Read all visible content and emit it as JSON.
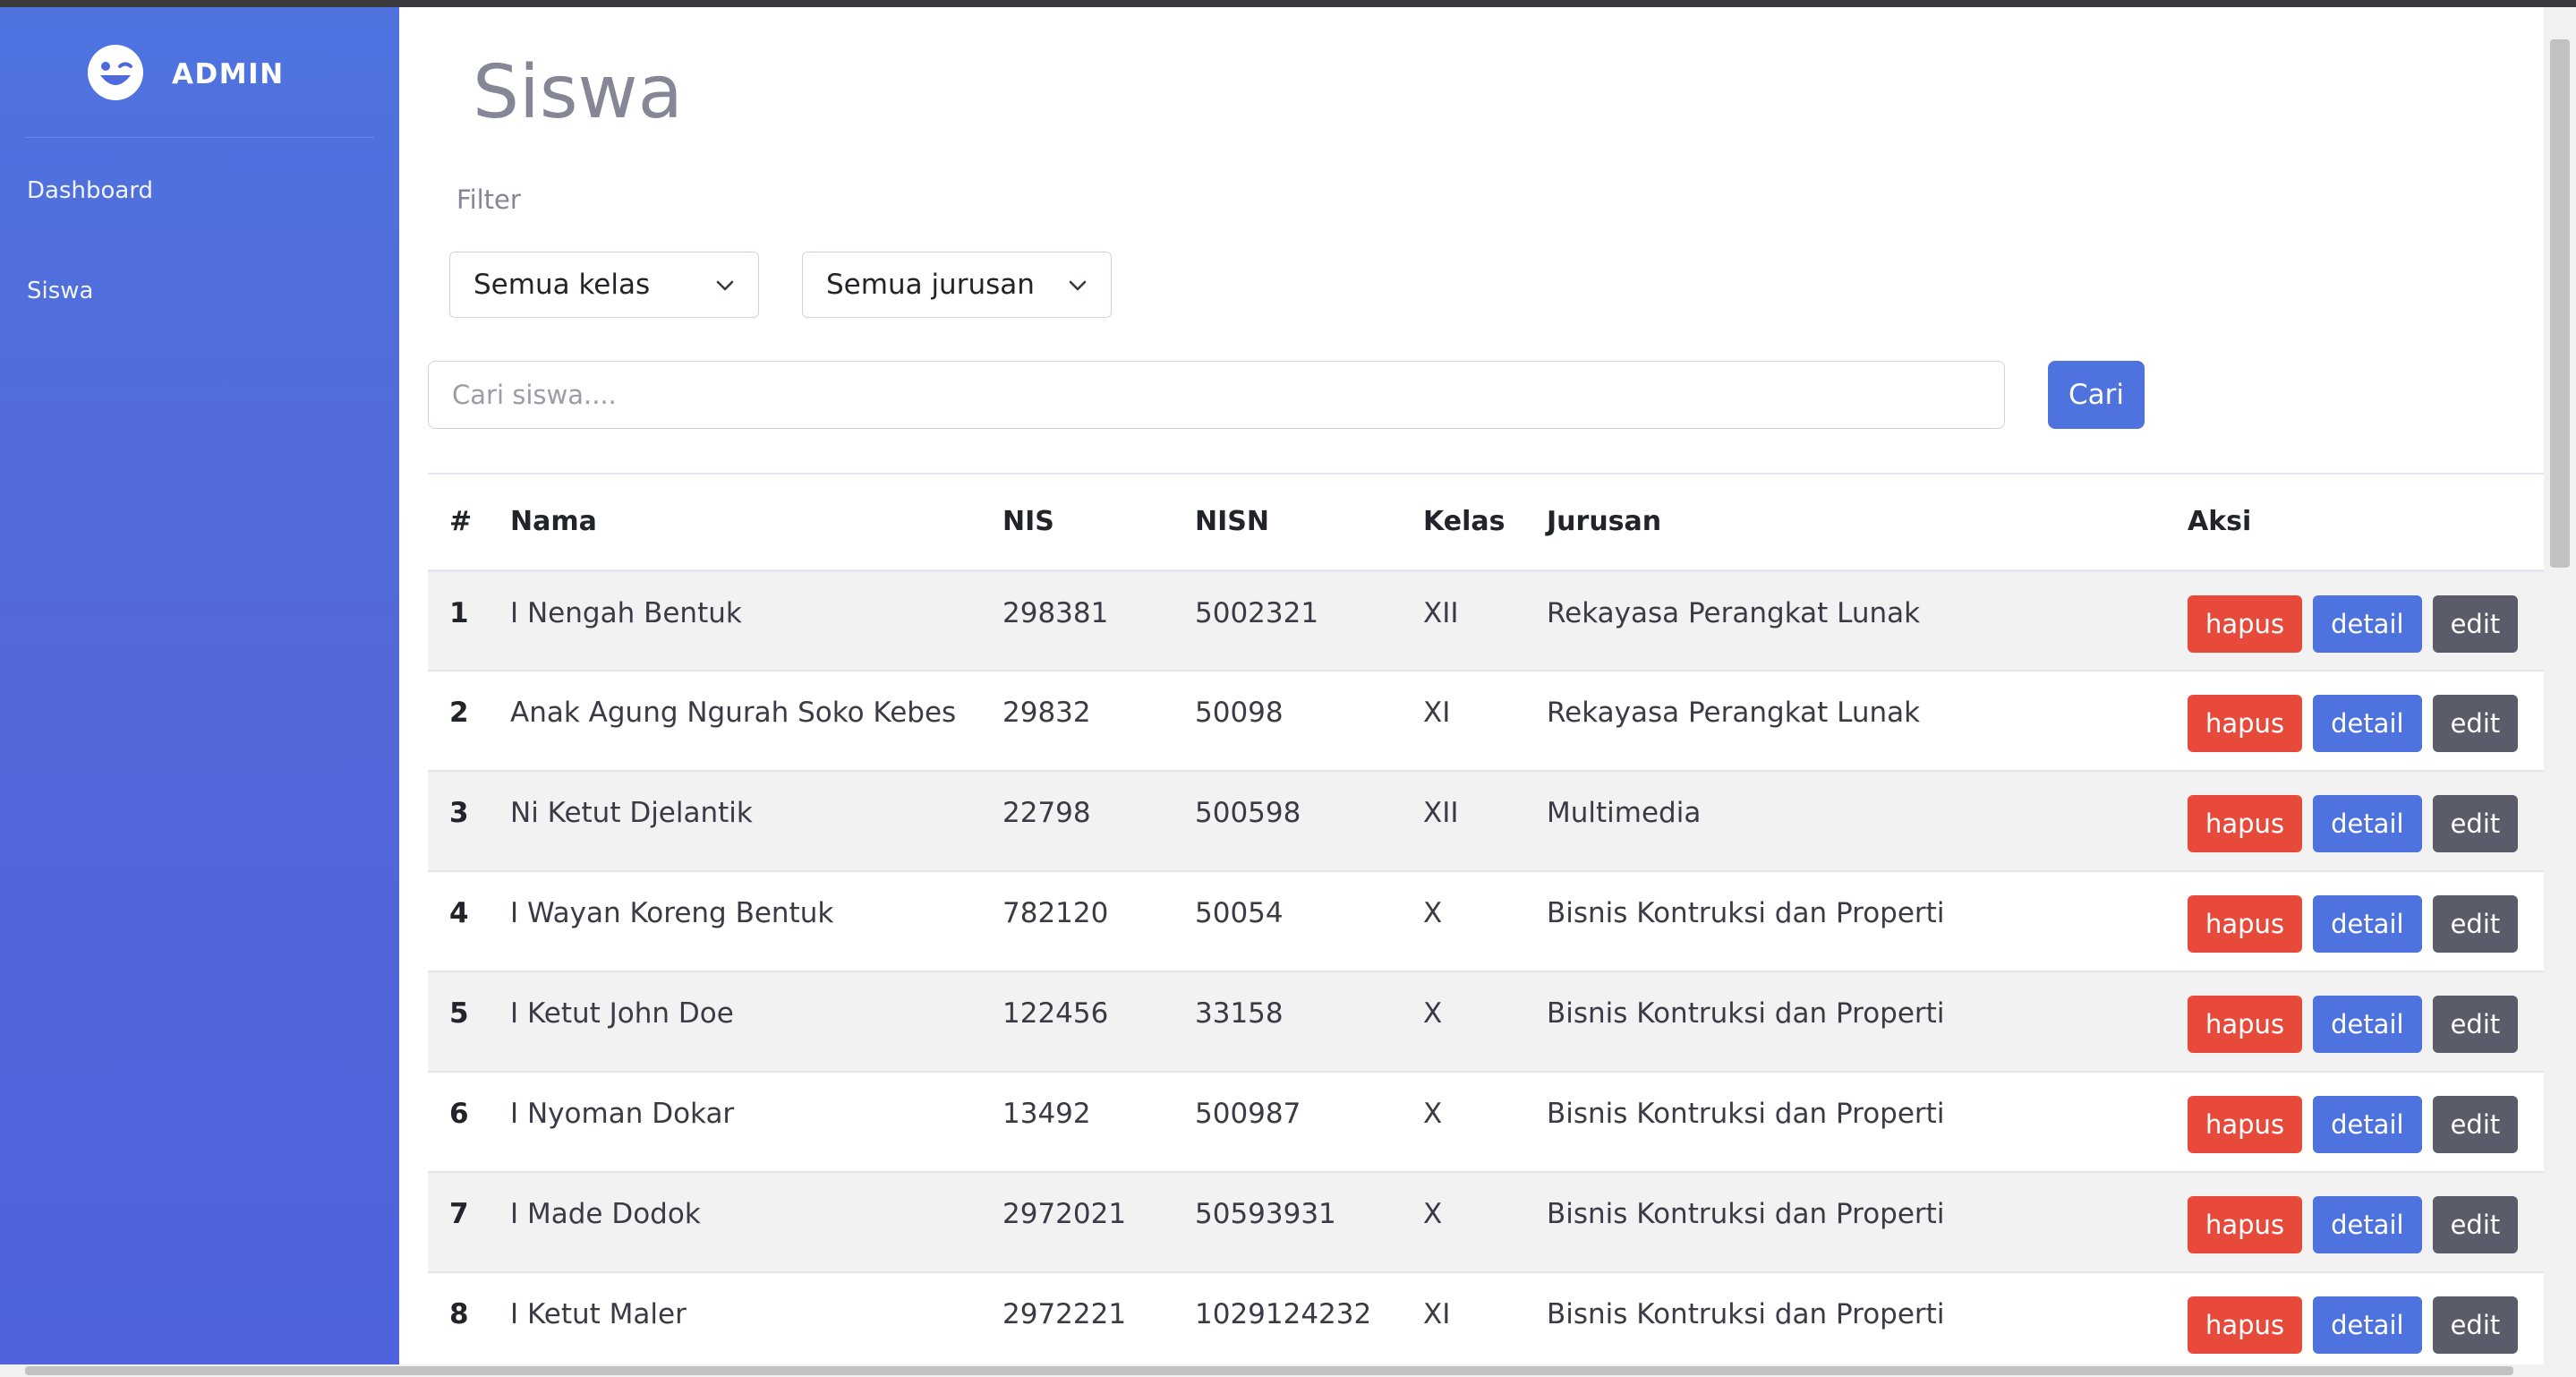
{
  "brand": {
    "name": "ADMIN",
    "logo_icon": "laugh-wink-icon"
  },
  "sidebar": {
    "items": [
      {
        "label": "Dashboard"
      },
      {
        "label": "Siswa"
      }
    ]
  },
  "page": {
    "title": "Siswa"
  },
  "filter": {
    "label": "Filter",
    "kelas_selected": "Semua kelas",
    "jurusan_selected": "Semua jurusan"
  },
  "search": {
    "placeholder": "Cari siswa....",
    "value": "",
    "button_label": "Cari"
  },
  "table": {
    "columns": [
      "#",
      "Nama",
      "NIS",
      "NISN",
      "Kelas",
      "Jurusan",
      "Aksi"
    ],
    "action_labels": {
      "delete": "hapus",
      "detail": "detail",
      "edit": "edit"
    },
    "rows": [
      {
        "no": "1",
        "nama": "I Nengah Bentuk",
        "nis": "298381",
        "nisn": "5002321",
        "kelas": "XII",
        "jurusan": "Rekayasa Perangkat Lunak"
      },
      {
        "no": "2",
        "nama": "Anak Agung Ngurah Soko Kebes",
        "nis": "29832",
        "nisn": "50098",
        "kelas": "XI",
        "jurusan": "Rekayasa Perangkat Lunak"
      },
      {
        "no": "3",
        "nama": "Ni Ketut Djelantik",
        "nis": "22798",
        "nisn": "500598",
        "kelas": "XII",
        "jurusan": "Multimedia"
      },
      {
        "no": "4",
        "nama": "I Wayan Koreng Bentuk",
        "nis": "782120",
        "nisn": "50054",
        "kelas": "X",
        "jurusan": "Bisnis Kontruksi dan Properti"
      },
      {
        "no": "5",
        "nama": "I Ketut John Doe",
        "nis": "122456",
        "nisn": "33158",
        "kelas": "X",
        "jurusan": "Bisnis Kontruksi dan Properti"
      },
      {
        "no": "6",
        "nama": "I Nyoman Dokar",
        "nis": "13492",
        "nisn": "500987",
        "kelas": "X",
        "jurusan": "Bisnis Kontruksi dan Properti"
      },
      {
        "no": "7",
        "nama": "I Made Dodok",
        "nis": "2972021",
        "nisn": "50593931",
        "kelas": "X",
        "jurusan": "Bisnis Kontruksi dan Properti"
      },
      {
        "no": "8",
        "nama": "I Ketut Maler",
        "nis": "2972221",
        "nisn": "1029124232",
        "kelas": "XI",
        "jurusan": "Bisnis Kontruksi dan Properti"
      }
    ]
  },
  "colors": {
    "sidebar": "#4e73df",
    "primary": "#4e73df",
    "danger": "#e74a3b",
    "secondary": "#5a5c69"
  }
}
